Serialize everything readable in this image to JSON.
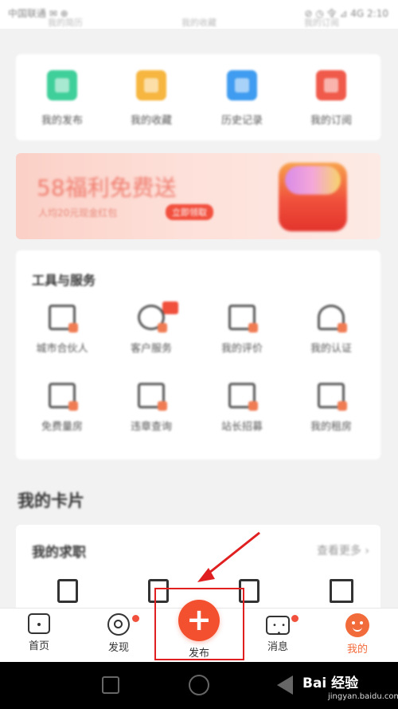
{
  "status": {
    "left": "中国联通 ✉ ⊕",
    "right": "⊘ ◷ 令 ⊿ 4G 2:10"
  },
  "top_ghost": [
    "我的简历",
    "我的收藏",
    "我的订阅"
  ],
  "quick_actions": [
    {
      "label": "我的发布",
      "color": "#3fcf9a"
    },
    {
      "label": "我的收藏",
      "color": "#f6b63f"
    },
    {
      "label": "历史记录",
      "color": "#3f9cf0"
    },
    {
      "label": "我的订阅",
      "color": "#f05a4a"
    }
  ],
  "banner": {
    "title": "58福利免费送",
    "subtitle": "人均20元现金红包",
    "pill": "立即领取"
  },
  "tools": {
    "title": "工具与服务",
    "items": [
      {
        "label": "城市合伙人"
      },
      {
        "label": "客户服务"
      },
      {
        "label": "我的评价"
      },
      {
        "label": "我的认证"
      },
      {
        "label": "免费量房"
      },
      {
        "label": "违章查询"
      },
      {
        "label": "站长招募"
      },
      {
        "label": "我的租房"
      }
    ]
  },
  "cards": {
    "title": "我的卡片"
  },
  "resume": {
    "title": "我的求职",
    "more": "查看更多"
  },
  "tabbar": {
    "home": "首页",
    "discover": "发现",
    "publish": "发布",
    "messages": "消息",
    "me": "我的"
  },
  "watermark": {
    "text": "Bai 经验",
    "sub": "jingyan.baidu.com"
  },
  "colors": {
    "accent": "#f3502f",
    "annotation": "#e02020"
  }
}
